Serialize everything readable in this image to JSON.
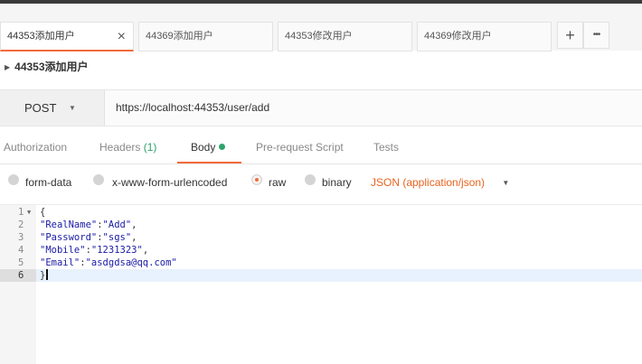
{
  "tabs": [
    {
      "label": "44353添加用户",
      "close": "×",
      "active": true
    },
    {
      "label": "44369添加用户",
      "active": false
    },
    {
      "label": "44353修改用户",
      "active": false
    },
    {
      "label": "44369修改用户",
      "active": false
    }
  ],
  "tab_actions": {
    "add": "+",
    "more": "•••"
  },
  "request": {
    "name": "44353添加用户",
    "caret": "▶"
  },
  "urlbar": {
    "method": "POST",
    "method_caret": "▼",
    "url": "https://localhost:44353/user/add"
  },
  "subtabs": {
    "authorization": "Authorization",
    "headers": "Headers",
    "headers_count": "(1)",
    "body": "Body",
    "prerequest": "Pre-request Script",
    "tests": "Tests"
  },
  "body_options": {
    "form_data": "form-data",
    "urlencoded": "x-www-form-urlencoded",
    "raw": "raw",
    "binary": "binary",
    "json": "JSON (application/json)",
    "json_caret": "▼",
    "selected": "raw"
  },
  "editor": {
    "fold_icon": "▼",
    "lines": [
      {
        "n": "1",
        "text": "{"
      },
      {
        "n": "2",
        "key": "\"RealName\"",
        "sep": ":",
        "val": "\"Add\"",
        "end": ","
      },
      {
        "n": "3",
        "key": "\"Password\"",
        "sep": ":",
        "val": "\"sgs\"",
        "end": ","
      },
      {
        "n": "4",
        "key": "\"Mobile\"",
        "sep": ":",
        "val": "\"1231323\"",
        "end": ","
      },
      {
        "n": "5",
        "key": "\"Email\"",
        "sep": ":",
        "val": "\"asdgdsa@qq.com\"",
        "end": ""
      },
      {
        "n": "6",
        "text": "}"
      }
    ]
  },
  "colors": {
    "accent": "#f26b3a",
    "green": "#2fa36b",
    "json_orange": "#e8641f"
  }
}
